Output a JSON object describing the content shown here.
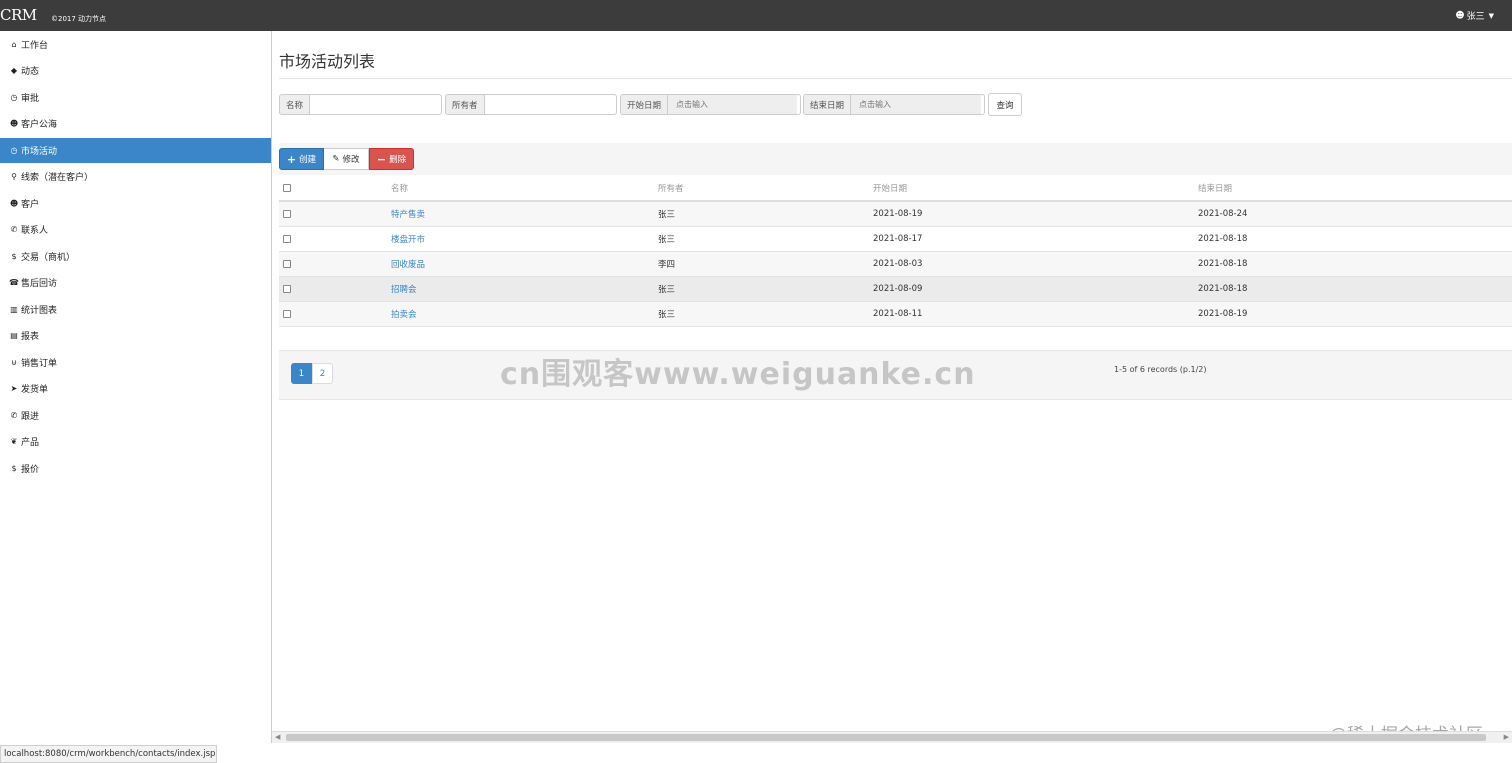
{
  "header": {
    "brand": "CRM",
    "brand_sub": "©2017 动力节点",
    "user": "张三",
    "user_icon": "user-icon",
    "caret_icon": "caret-down-icon"
  },
  "sidebar": {
    "active_index": 4,
    "items": [
      {
        "label": "工作台",
        "icon": "home-icon",
        "glyph": "⌂"
      },
      {
        "label": "动态",
        "icon": "tag-icon",
        "glyph": "◆"
      },
      {
        "label": "审批",
        "icon": "clock-icon",
        "glyph": "◷"
      },
      {
        "label": "客户公海",
        "icon": "user-icon",
        "glyph": "☻"
      },
      {
        "label": "市场活动",
        "icon": "clock-icon",
        "glyph": "◷"
      },
      {
        "label": "线索（潜在客户）",
        "icon": "search-icon",
        "glyph": "⚲"
      },
      {
        "label": "客户",
        "icon": "user-icon",
        "glyph": "☻"
      },
      {
        "label": "联系人",
        "icon": "phone-icon",
        "glyph": "✆"
      },
      {
        "label": "交易（商机）",
        "icon": "dollar-icon",
        "glyph": "$"
      },
      {
        "label": "售后回访",
        "icon": "telephone-icon",
        "glyph": "☎"
      },
      {
        "label": "统计图表",
        "icon": "bar-chart-icon",
        "glyph": "▥"
      },
      {
        "label": "报表",
        "icon": "file-icon",
        "glyph": "▤"
      },
      {
        "label": "销售订单",
        "icon": "cart-icon",
        "glyph": "⊍"
      },
      {
        "label": "发货单",
        "icon": "send-icon",
        "glyph": "➤"
      },
      {
        "label": "跟进",
        "icon": "phone-icon",
        "glyph": "✆"
      },
      {
        "label": "产品",
        "icon": "leaf-icon",
        "glyph": "❦"
      },
      {
        "label": "报价",
        "icon": "dollar-icon",
        "glyph": "$"
      }
    ]
  },
  "main": {
    "title": "市场活动列表",
    "search": {
      "name_label": "名称",
      "name_value": "",
      "owner_label": "所有者",
      "owner_value": "",
      "start_label": "开始日期",
      "start_placeholder": "点击输入",
      "end_label": "结束日期",
      "end_placeholder": "点击输入",
      "query_button": "查询"
    },
    "toolbar": {
      "create": "创建",
      "edit": "修改",
      "delete": "删除",
      "create_icon": "plus-icon",
      "edit_icon": "pencil-icon",
      "delete_icon": "minus-icon"
    },
    "table": {
      "headers": [
        "名称",
        "所有者",
        "开始日期",
        "结束日期"
      ],
      "rows": [
        {
          "name": "特产售卖",
          "owner": "张三",
          "start": "2021-08-19",
          "end": "2021-08-24"
        },
        {
          "name": "楼盘开市",
          "owner": "张三",
          "start": "2021-08-17",
          "end": "2021-08-18"
        },
        {
          "name": "回收废品",
          "owner": "李四",
          "start": "2021-08-03",
          "end": "2021-08-18"
        },
        {
          "name": "招聘会",
          "owner": "张三",
          "start": "2021-08-09",
          "end": "2021-08-18"
        },
        {
          "name": "拍卖会",
          "owner": "张三",
          "start": "2021-08-11",
          "end": "2021-08-19"
        }
      ]
    },
    "pagination": {
      "pages": [
        "1",
        "2"
      ],
      "current": "1",
      "records": "1-5 of 6 records (p.1/2)"
    }
  },
  "watermarks": {
    "center": "cn围观客www.weiguanke.cn",
    "corner": "@稀土掘金技术社区"
  },
  "status_bar": {
    "url": "localhost:8080/crm/workbench/contacts/index.jsp"
  }
}
